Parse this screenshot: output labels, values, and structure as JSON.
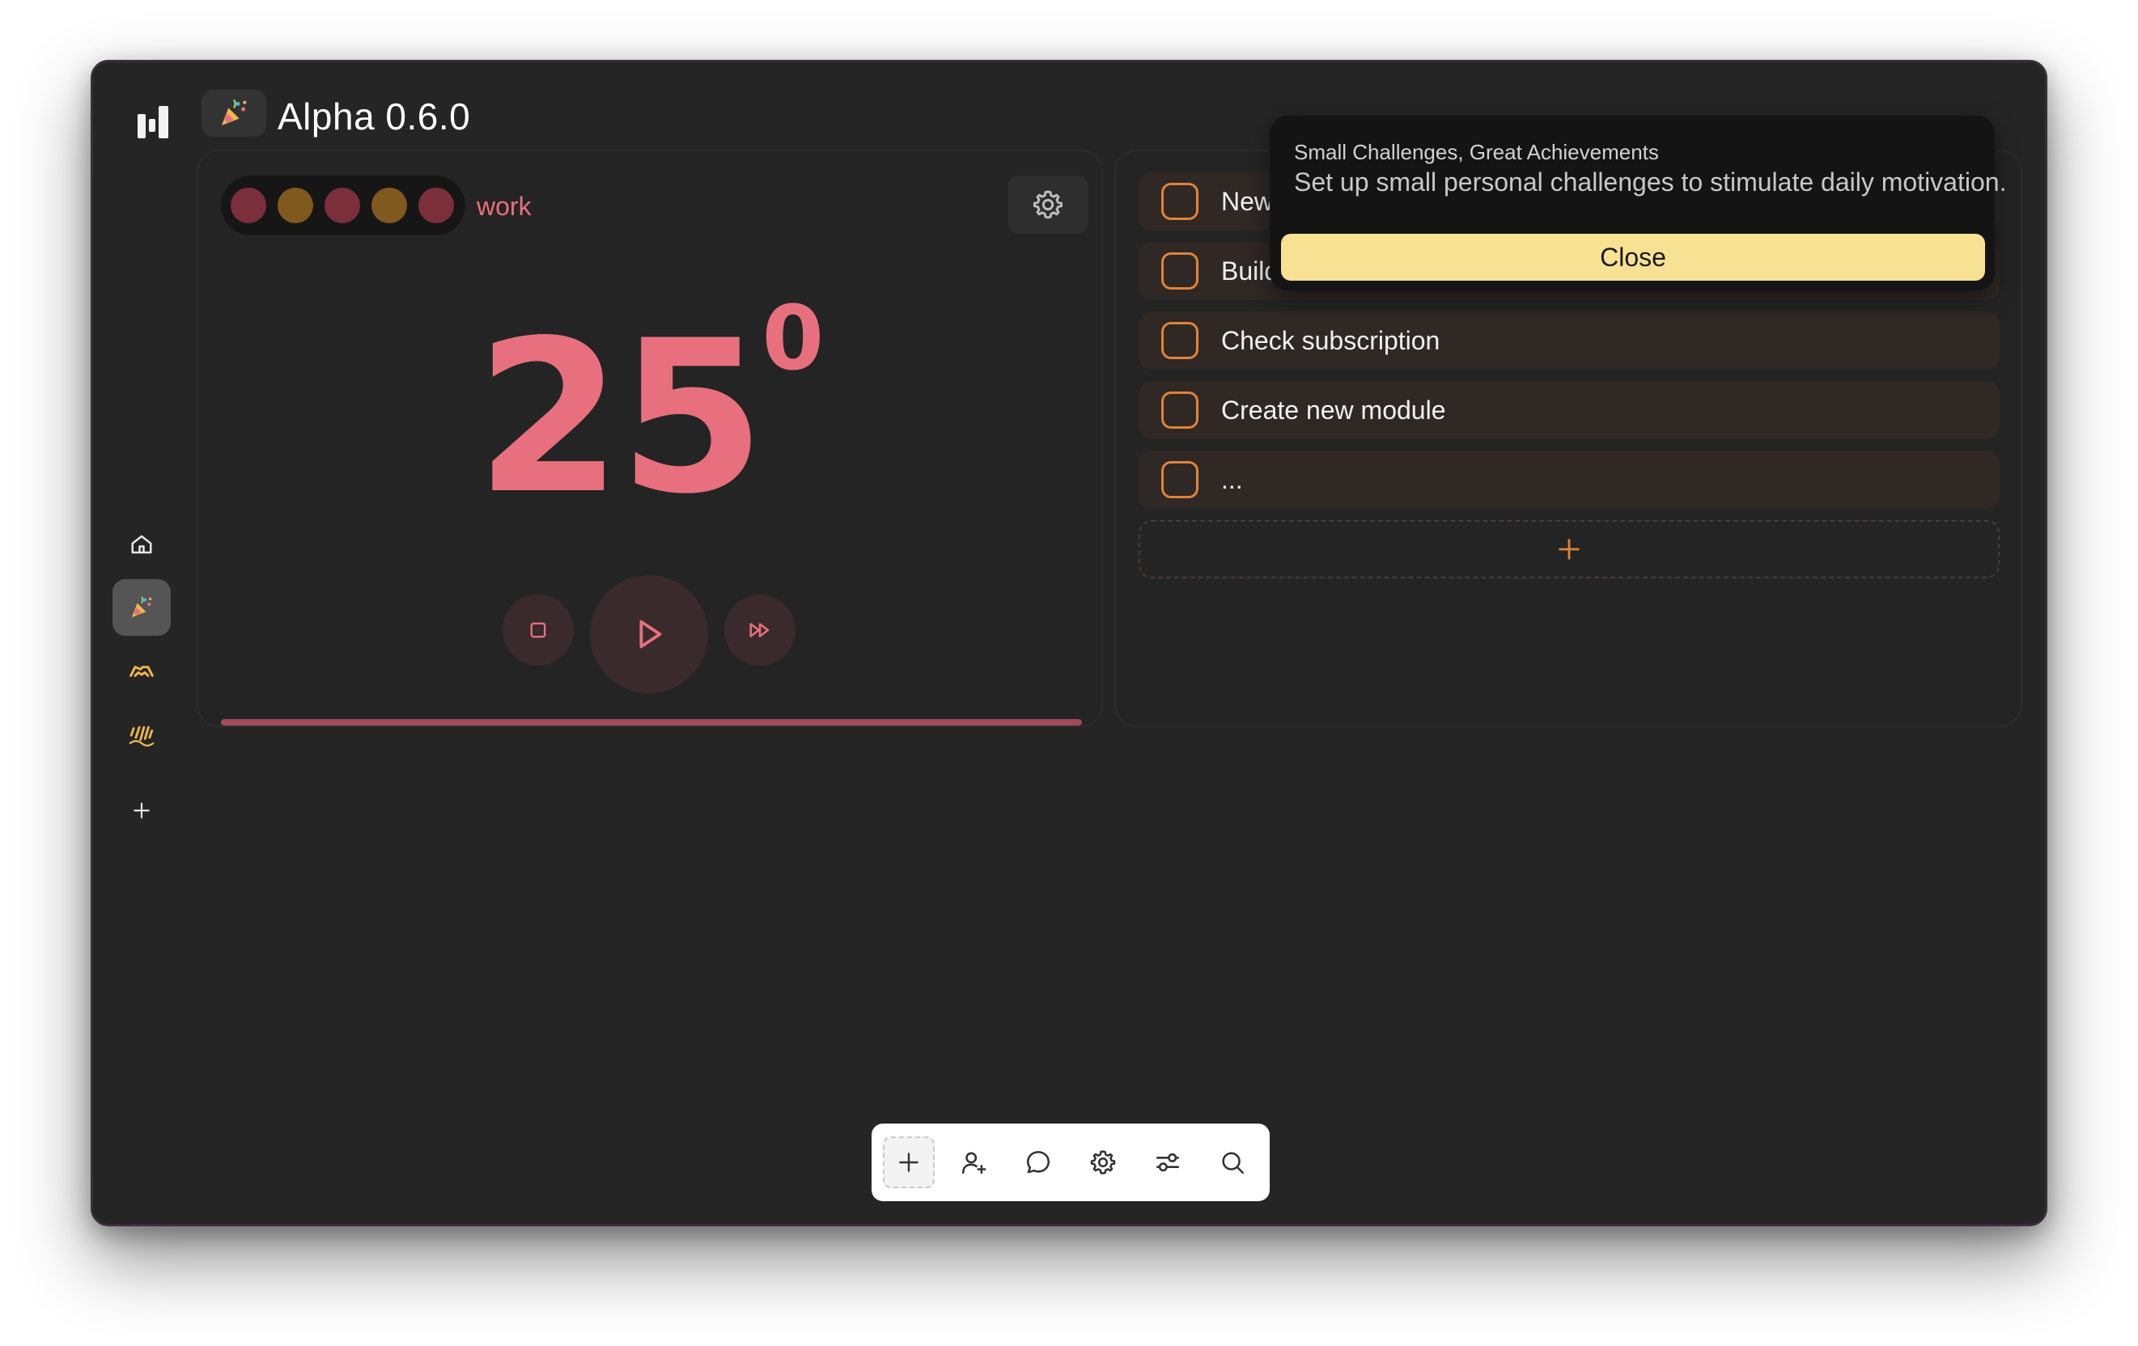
{
  "app": {
    "header": {
      "title": "Alpha 0.6.0",
      "icon": "party-popper-icon"
    },
    "sidebar": {
      "items": [
        {
          "name": "home",
          "icon": "home-icon"
        },
        {
          "name": "party",
          "icon": "party-popper-icon",
          "active": true
        },
        {
          "name": "handshake",
          "icon": "handshake-icon"
        },
        {
          "name": "rain",
          "icon": "rain-icon"
        },
        {
          "name": "add",
          "icon": "plus-icon"
        }
      ]
    }
  },
  "timer": {
    "mode": "work",
    "minutes": "25",
    "seconds": "0",
    "progress": 1.0,
    "session_dots": [
      "#7a2f3a",
      "#80591e",
      "#7a2f3a",
      "#80591e",
      "#7a2f3a"
    ],
    "accent_color": "#e8707e"
  },
  "tasks": {
    "items": [
      {
        "label": "New"
      },
      {
        "label": "Build"
      },
      {
        "label": "Check subscription"
      },
      {
        "label": "Create new module"
      },
      {
        "label": "..."
      }
    ],
    "checkbox_color": "#e0833a"
  },
  "tooltip": {
    "title": "Small Challenges, Great Achievements",
    "text": "Set up small personal challenges to stimulate daily motivation.",
    "close_label": "Close"
  },
  "toolbar": {
    "tools": [
      "plus-icon",
      "add-user-icon",
      "chat-icon",
      "gear-icon",
      "sliders-icon",
      "search-icon"
    ]
  }
}
